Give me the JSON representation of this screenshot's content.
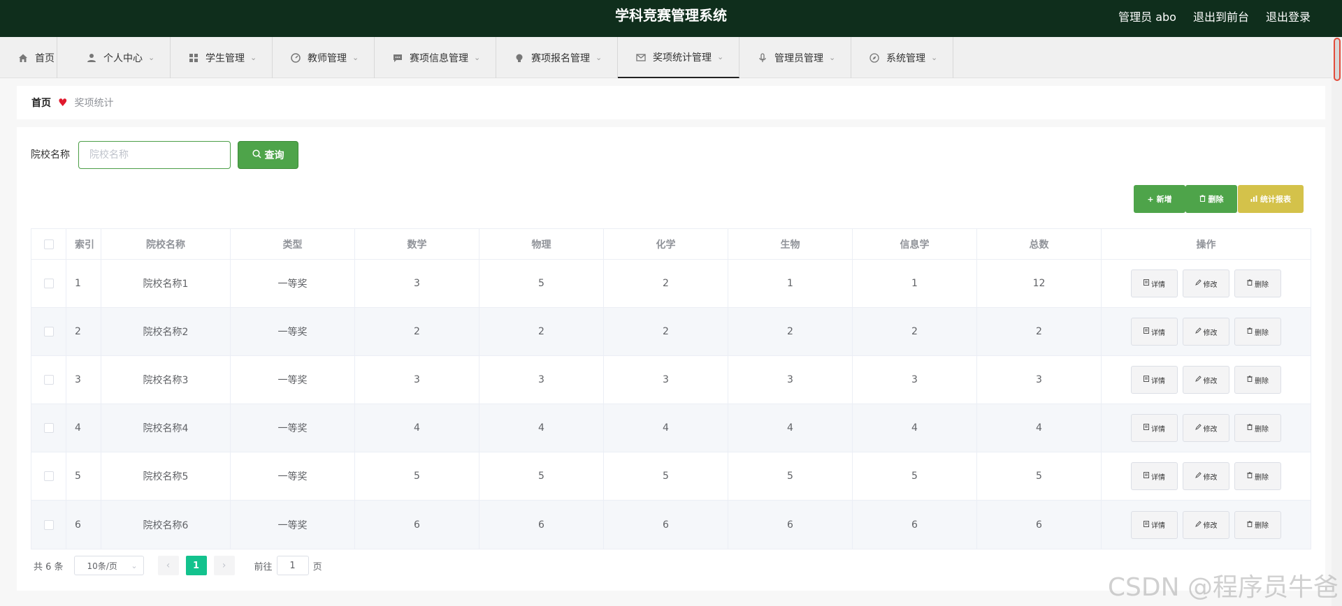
{
  "header": {
    "title": "学科竞赛管理系统",
    "user": "管理员 abo",
    "to_front": "退出到前台",
    "logout": "退出登录"
  },
  "nav": [
    {
      "label": "首页",
      "icon": "home-icon"
    },
    {
      "label": "个人中心",
      "icon": "user-icon"
    },
    {
      "label": "学生管理",
      "icon": "grid-icon"
    },
    {
      "label": "教师管理",
      "icon": "dashboard-icon"
    },
    {
      "label": "赛项信息管理",
      "icon": "chat-icon"
    },
    {
      "label": "赛项报名管理",
      "icon": "bulb-icon"
    },
    {
      "label": "奖项统计管理",
      "icon": "mail-icon",
      "active": true
    },
    {
      "label": "管理员管理",
      "icon": "mic-icon"
    },
    {
      "label": "系统管理",
      "icon": "compass-icon"
    }
  ],
  "breadcrumb": {
    "home": "首页",
    "current": "奖项统计"
  },
  "search": {
    "label": "院校名称",
    "placeholder": "院校名称",
    "button": "查询"
  },
  "actions": {
    "add": "新增",
    "delete": "删除",
    "stats": "统计报表"
  },
  "table": {
    "headers": [
      "索引",
      "院校名称",
      "类型",
      "数学",
      "物理",
      "化学",
      "生物",
      "信息学",
      "总数",
      "操作"
    ],
    "rows": [
      [
        "1",
        "院校名称1",
        "一等奖",
        "3",
        "5",
        "2",
        "1",
        "1",
        "12"
      ],
      [
        "2",
        "院校名称2",
        "一等奖",
        "2",
        "2",
        "2",
        "2",
        "2",
        "2"
      ],
      [
        "3",
        "院校名称3",
        "一等奖",
        "3",
        "3",
        "3",
        "3",
        "3",
        "3"
      ],
      [
        "4",
        "院校名称4",
        "一等奖",
        "4",
        "4",
        "4",
        "4",
        "4",
        "4"
      ],
      [
        "5",
        "院校名称5",
        "一等奖",
        "5",
        "5",
        "5",
        "5",
        "5",
        "5"
      ],
      [
        "6",
        "院校名称6",
        "一等奖",
        "6",
        "6",
        "6",
        "6",
        "6",
        "6"
      ]
    ],
    "ops": {
      "detail": "详情",
      "edit": "修改",
      "delete": "删除"
    }
  },
  "pagination": {
    "total": "共 6 条",
    "page_size": "10条/页",
    "current": "1",
    "goto_prefix": "前往",
    "goto_value": "1",
    "goto_suffix": "页"
  },
  "watermark": "CSDN @程序员牛爸",
  "colors": {
    "header_bg": "#0f2e1c",
    "primary_green": "#4ea44a",
    "stat_yellow": "#d4c24a",
    "page_active": "#13c28d",
    "heart": "#e0192d"
  }
}
